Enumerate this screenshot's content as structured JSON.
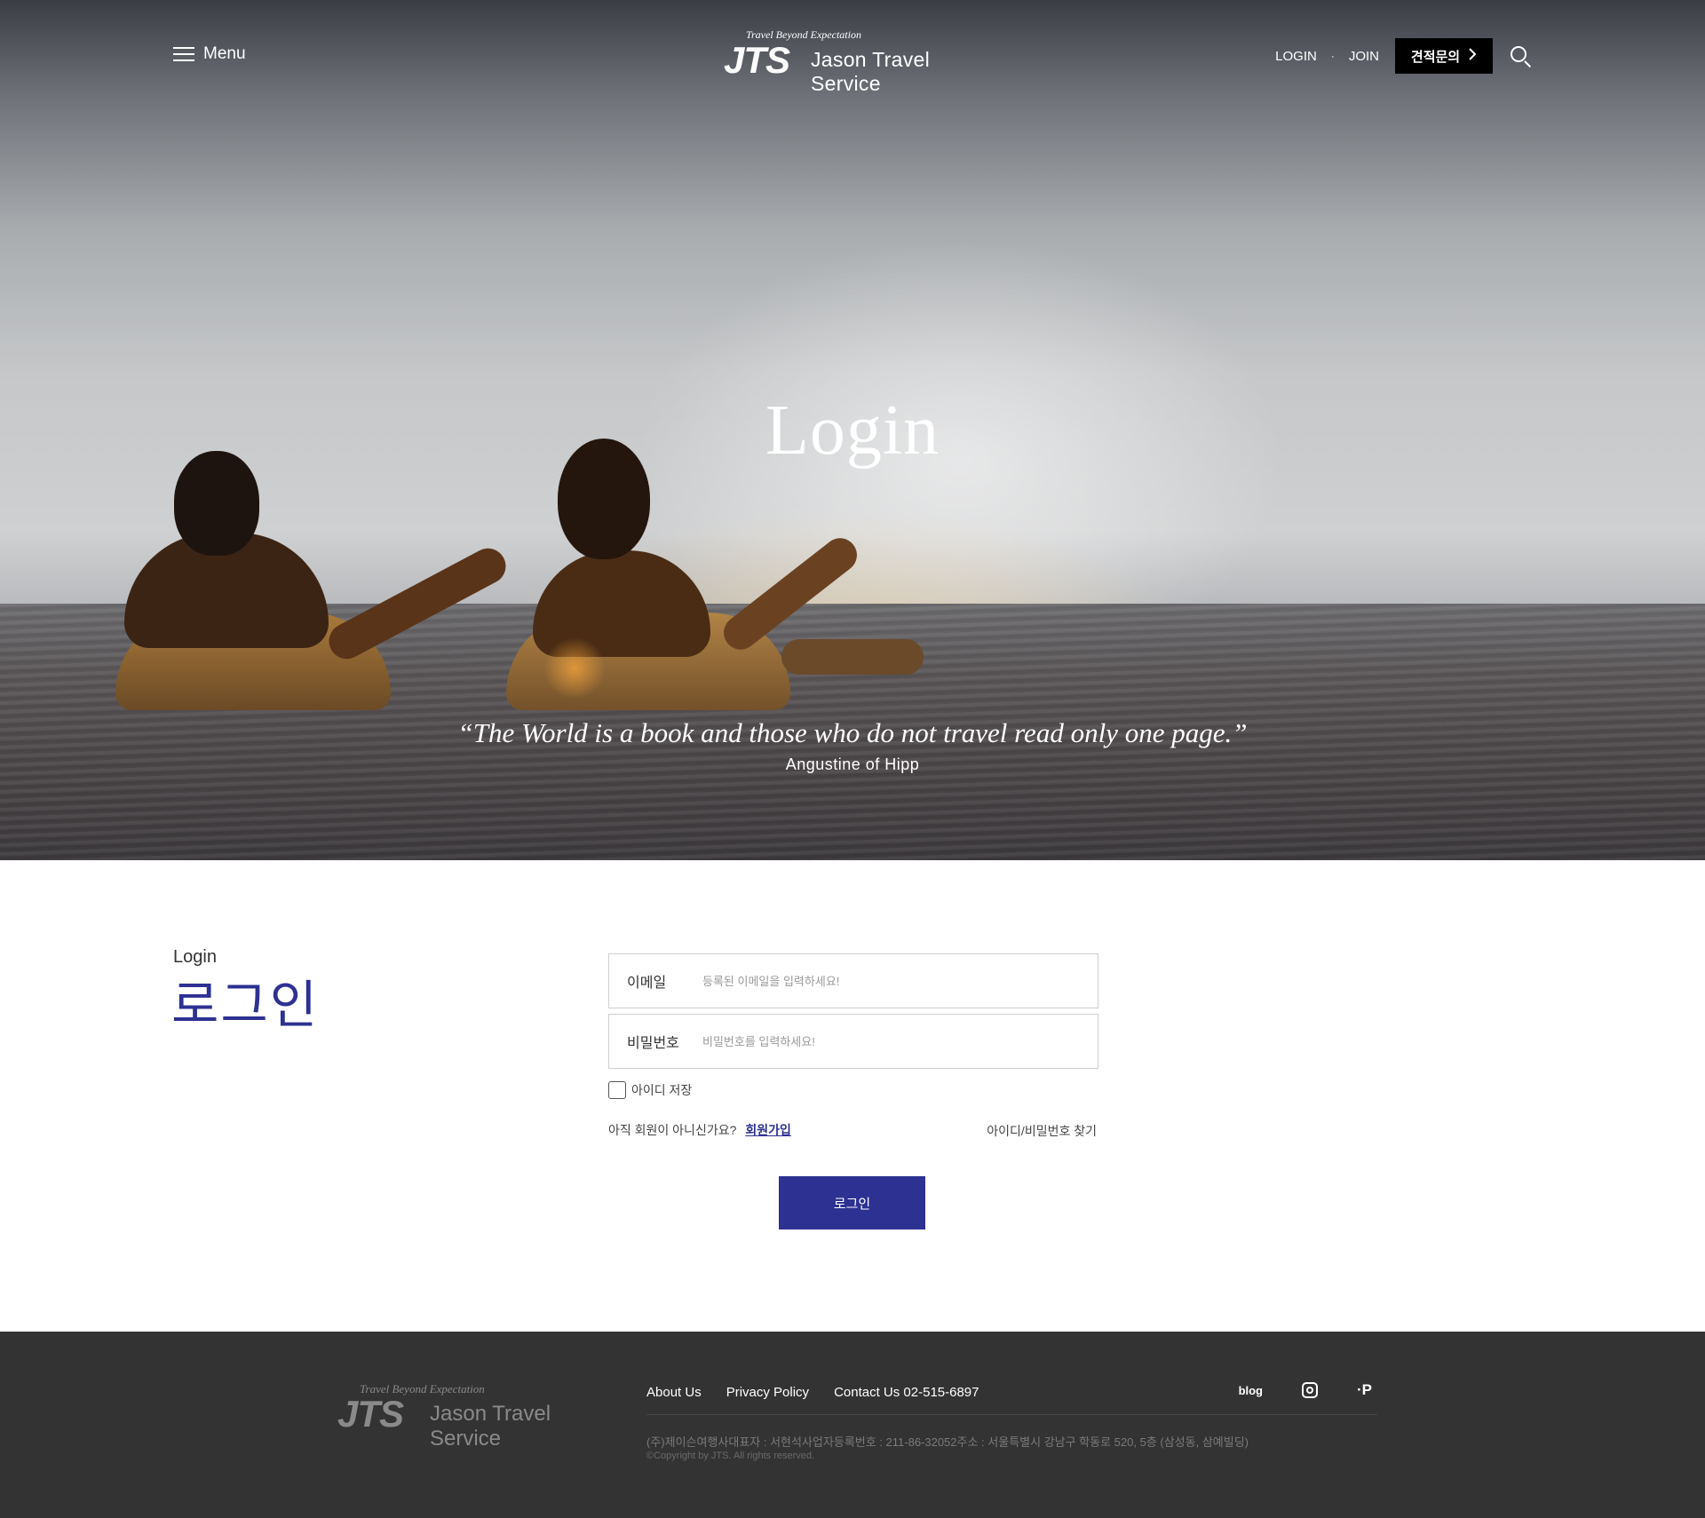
{
  "header": {
    "menu_label": "Menu",
    "logo": {
      "tagline": "Travel Beyond Expectation",
      "mark": "JTS",
      "name": "Jason Travel Service"
    },
    "login": "LOGIN",
    "join": "JOIN",
    "separator": "·",
    "quote_button": "견적문의",
    "quote_chevron": "›"
  },
  "hero": {
    "title": "Login",
    "quote": "“The World is a book and those who do not travel read only one page.”",
    "author": "Angustine of Hipp"
  },
  "login_section": {
    "label_en": "Login",
    "label_ko": "로그인",
    "email_label": "이메일",
    "email_placeholder": "등록된 이메일을 입력하세요!",
    "password_label": "비밀번호",
    "password_placeholder": "비밀번호를 입력하세요!",
    "remember_label": "아이디 저장",
    "not_member_text": "아직 회원이 아니신가요?",
    "join_link": "회원가입",
    "find_link": "아이디/비밀번호 찾기",
    "submit_label": "로그인"
  },
  "footer": {
    "logo": {
      "tagline": "Travel Beyond Expectation",
      "mark": "JTS",
      "name": "Jason Travel Service"
    },
    "links": [
      "About Us",
      "Privacy Policy",
      "Contact Us 02-515-6897"
    ],
    "social": {
      "blog": "blog",
      "post": "·P"
    },
    "info": "(주)제이슨여행사대표자 : 서현석사업자등록번호 : 211-86-32052주소 : 서울특별시 강남구 학동로 520, 5층 (삼성동, 삼예빌딩)",
    "copyright": "©Copyright by JTS. All rights reserved."
  },
  "colors": {
    "accent": "#2d3192",
    "footer_bg": "#333333",
    "quote_button_bg": "#000000"
  },
  "icons": {
    "menu": "hamburger-icon",
    "search": "search-icon",
    "chevron": "chevron-right-icon",
    "instagram": "instagram-icon",
    "blog": "blog-icon",
    "post": "post-icon"
  }
}
